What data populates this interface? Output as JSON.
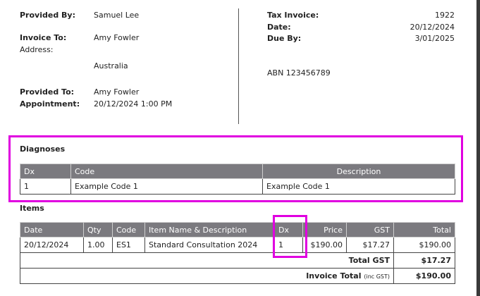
{
  "header": {
    "provided_by_label": "Provided By:",
    "provided_by_value": "Samuel Lee",
    "invoice_to_label": "Invoice To:",
    "invoice_to_value": "Amy Fowler",
    "address_label": "Address:",
    "address_country": "Australia",
    "provided_to_label": "Provided To:",
    "provided_to_value": "Amy Fowler",
    "appointment_label": "Appointment:",
    "appointment_value": "20/12/2024 1:00 PM",
    "tax_invoice_label": "Tax Invoice:",
    "tax_invoice_value": "1922",
    "date_label": "Date:",
    "date_value": "20/12/2024",
    "due_by_label": "Due By:",
    "due_by_value": "3/01/2025",
    "abn": "ABN 123456789"
  },
  "diagnoses": {
    "title": "Diagnoses",
    "columns": {
      "dx": "Dx",
      "code": "Code",
      "description": "Description"
    },
    "rows": [
      {
        "dx": "1",
        "code": "Example Code 1",
        "description": "Example Code 1"
      }
    ]
  },
  "items": {
    "title": "Items",
    "columns": {
      "date": "Date",
      "qty": "Qty",
      "code": "Code",
      "name": "Item Name & Description",
      "dx": "Dx",
      "price": "Price",
      "gst": "GST",
      "total": "Total"
    },
    "rows": [
      {
        "date": "20/12/2024",
        "qty": "1.00",
        "code": "ES1",
        "name": "Standard Consultation 2024",
        "dx": "1",
        "price": "$190.00",
        "gst": "$17.27",
        "total": "$190.00"
      }
    ],
    "total_gst_label": "Total GST",
    "total_gst_value": "$17.27",
    "invoice_total_label": "Invoice Total",
    "invoice_total_note": "(inc GST)",
    "invoice_total_value": "$190.00"
  },
  "colors": {
    "highlight": "#e000e0",
    "table_header": "#7b7a7f"
  }
}
